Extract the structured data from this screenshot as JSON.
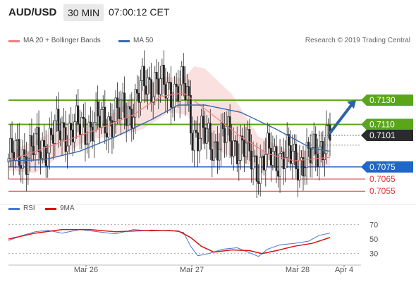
{
  "header": {
    "pair": "AUD/USD",
    "timeframe": "30 MIN",
    "time": "07:00:12 CET"
  },
  "legend": {
    "bollinger_label": "MA 20 + Bollinger Bands",
    "ma50_label": "MA 50",
    "research": "Research © 2019 Trading Central"
  },
  "colors": {
    "bollinger": "#f08080",
    "band_fill": "#fbe0e0",
    "ma50": "#3a6aa8",
    "target": "#5aa619",
    "pivot": "#2166c9",
    "support": "#d9393a",
    "last": "#2b2b2b",
    "arrow": "#2e62a6",
    "rsi": "#4a78d0",
    "rsi_ma": "#dd1111"
  },
  "levels": [
    {
      "value": 0.713,
      "label": "0.7130",
      "kind": "target"
    },
    {
      "value": 0.711,
      "label": "0.7110",
      "kind": "target"
    },
    {
      "value": 0.7101,
      "label": "0.7101",
      "kind": "last"
    },
    {
      "value": 0.7075,
      "label": "0.7075",
      "kind": "pivot"
    },
    {
      "value": 0.7065,
      "label": "0.7065",
      "kind": "support"
    },
    {
      "value": 0.7055,
      "label": "0.7055",
      "kind": "support"
    }
  ],
  "chart_data": [
    {
      "type": "candlestick",
      "title": "AUD/USD 30 MIN",
      "price_range": [
        0.7047,
        0.7169
      ],
      "x_ticks": [
        "Mar 26",
        "Mar 27",
        "Mar 28",
        "Apr 4"
      ],
      "close_anchors": [
        [
          0,
          0.7082
        ],
        [
          10,
          0.7087
        ],
        [
          20,
          0.7093
        ],
        [
          26,
          0.7103
        ],
        [
          30,
          0.7105
        ],
        [
          38,
          0.7106
        ],
        [
          45,
          0.7109
        ],
        [
          52,
          0.7112
        ],
        [
          60,
          0.7117
        ],
        [
          70,
          0.7125
        ],
        [
          77,
          0.7145
        ],
        [
          82,
          0.7146
        ],
        [
          86,
          0.7139
        ],
        [
          96,
          0.714
        ],
        [
          100,
          0.7134
        ],
        [
          103,
          0.7105
        ],
        [
          108,
          0.71
        ],
        [
          115,
          0.7095
        ],
        [
          122,
          0.71
        ],
        [
          128,
          0.7094
        ],
        [
          133,
          0.7088
        ],
        [
          140,
          0.7077
        ],
        [
          145,
          0.7083
        ],
        [
          152,
          0.7085
        ],
        [
          160,
          0.7082
        ],
        [
          168,
          0.708
        ],
        [
          174,
          0.7093
        ],
        [
          180,
          0.7101
        ]
      ],
      "candle_count": 181,
      "bollinger_ma20": [
        [
          0,
          0.708
        ],
        [
          25,
          0.7093
        ],
        [
          50,
          0.7106
        ],
        [
          70,
          0.7118
        ],
        [
          85,
          0.7133
        ],
        [
          98,
          0.7136
        ],
        [
          108,
          0.7125
        ],
        [
          130,
          0.71
        ],
        [
          145,
          0.7086
        ],
        [
          160,
          0.708
        ],
        [
          180,
          0.7083
        ]
      ],
      "bollinger_upper": [
        [
          0,
          0.7087
        ],
        [
          20,
          0.71
        ],
        [
          30,
          0.7112
        ],
        [
          50,
          0.711
        ],
        [
          70,
          0.7132
        ],
        [
          85,
          0.715
        ],
        [
          98,
          0.7148
        ],
        [
          104,
          0.7158
        ],
        [
          110,
          0.7156
        ],
        [
          125,
          0.7135
        ],
        [
          140,
          0.71
        ],
        [
          155,
          0.709
        ],
        [
          180,
          0.7087
        ]
      ],
      "bollinger_lower": [
        [
          0,
          0.7072
        ],
        [
          15,
          0.707
        ],
        [
          25,
          0.708
        ],
        [
          45,
          0.7098
        ],
        [
          60,
          0.71
        ],
        [
          75,
          0.7106
        ],
        [
          90,
          0.712
        ],
        [
          100,
          0.7118
        ],
        [
          108,
          0.7097
        ],
        [
          118,
          0.7088
        ],
        [
          130,
          0.708
        ],
        [
          140,
          0.7073
        ],
        [
          160,
          0.7075
        ],
        [
          180,
          0.7076
        ]
      ],
      "ma50": [
        [
          0,
          0.708
        ],
        [
          20,
          0.7081
        ],
        [
          40,
          0.7088
        ],
        [
          60,
          0.71
        ],
        [
          80,
          0.7114
        ],
        [
          95,
          0.7126
        ],
        [
          110,
          0.7126
        ],
        [
          130,
          0.712
        ],
        [
          150,
          0.7106
        ],
        [
          170,
          0.709
        ],
        [
          180,
          0.7088
        ]
      ],
      "forecast_arrow": {
        "from": [
          180,
          0.7103
        ],
        "to": [
          200,
          0.713
        ]
      }
    },
    {
      "type": "line",
      "title": "RSI",
      "series": [
        {
          "name": "RSI",
          "points": [
            [
              0,
              48
            ],
            [
              8,
              55
            ],
            [
              15,
              60
            ],
            [
              22,
              62
            ],
            [
              30,
              58
            ],
            [
              40,
              63
            ],
            [
              50,
              60
            ],
            [
              60,
              57
            ],
            [
              70,
              63
            ],
            [
              80,
              61
            ],
            [
              90,
              62
            ],
            [
              98,
              59
            ],
            [
              102,
              40
            ],
            [
              106,
              27
            ],
            [
              112,
              30
            ],
            [
              120,
              36
            ],
            [
              128,
              38
            ],
            [
              133,
              33
            ],
            [
              140,
              26
            ],
            [
              145,
              36
            ],
            [
              152,
              42
            ],
            [
              160,
              44
            ],
            [
              168,
              47
            ],
            [
              174,
              55
            ],
            [
              180,
              58
            ]
          ]
        },
        {
          "name": "9MA",
          "points": [
            [
              0,
              50
            ],
            [
              15,
              58
            ],
            [
              30,
              63
            ],
            [
              45,
              63
            ],
            [
              60,
              60
            ],
            [
              80,
              62
            ],
            [
              95,
              61
            ],
            [
              102,
              52
            ],
            [
              108,
              40
            ],
            [
              115,
              32
            ],
            [
              125,
              35
            ],
            [
              135,
              34
            ],
            [
              142,
              30
            ],
            [
              150,
              34
            ],
            [
              160,
              40
            ],
            [
              170,
              44
            ],
            [
              180,
              52
            ]
          ]
        }
      ],
      "ylim": [
        20,
        80
      ],
      "yticks": [
        30,
        50,
        70
      ],
      "reference_lines": [
        30,
        70
      ]
    }
  ],
  "rsi_legend": {
    "rsi": "RSI",
    "ma": "9MA"
  }
}
